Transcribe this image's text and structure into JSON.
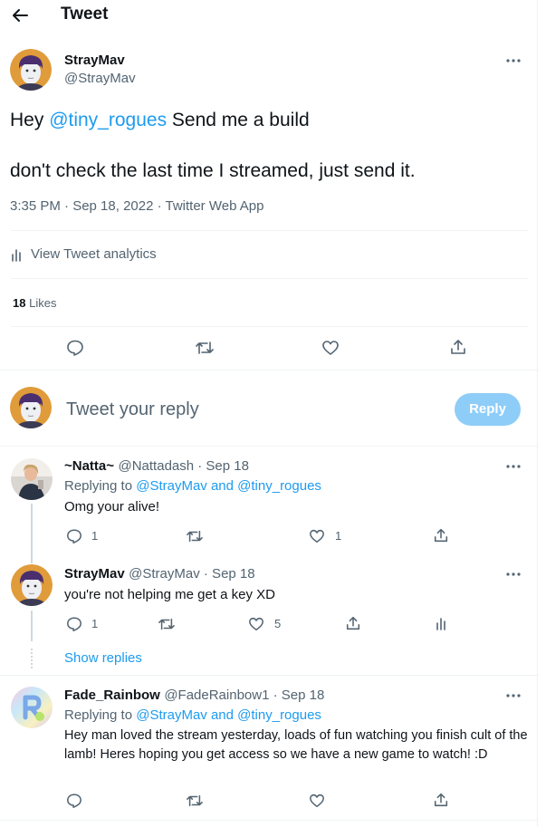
{
  "header": {
    "title": "Tweet"
  },
  "main_tweet": {
    "display_name": "StrayMav",
    "handle": "@StrayMav",
    "text_prefix": "Hey ",
    "mention": "@tiny_rogues",
    "text_suffix": " Send me a build",
    "text_line2": "don't check the last time I streamed, just send it.",
    "meta": "3:35 PM · Sep 18, 2022 · Twitter Web App",
    "analytics_label": "View Tweet analytics",
    "likes_count": "18",
    "likes_label": "Likes"
  },
  "composer": {
    "placeholder": "Tweet your reply",
    "reply_button": "Reply"
  },
  "replies": [
    {
      "display_name": "~Natta~",
      "handle_date": "@Nattadash · Sep 18",
      "replying_prefix": "Replying to ",
      "replying_users": "@StrayMav and @tiny_rogues",
      "text": "Omg your alive!",
      "reply_count": "1",
      "like_count": "1"
    },
    {
      "display_name": "StrayMav",
      "handle_date": "@StrayMav · Sep 18",
      "text": "you're not helping me get a key XD",
      "reply_count": "1",
      "like_count": "5"
    },
    {
      "display_name": "Fade_Rainbow",
      "handle_date": "@FadeRainbow1 · Sep 18",
      "replying_prefix": "Replying to ",
      "replying_users": "@StrayMav and @tiny_rogues",
      "text": "Hey man loved the stream yesterday, loads of fun watching you finish cult of the lamb! Heres hoping you get access so we have a new game to watch! :D"
    }
  ],
  "show_replies_label": "Show replies",
  "colors": {
    "accent": "#1d9bf0",
    "reply_button_disabled": "#8ecdf8",
    "muted_text": "#536471",
    "divider": "#eff3f4"
  },
  "icons": [
    "back-arrow-icon",
    "more-icon",
    "reply-icon",
    "retweet-icon",
    "like-icon",
    "share-icon",
    "analytics-icon"
  ]
}
